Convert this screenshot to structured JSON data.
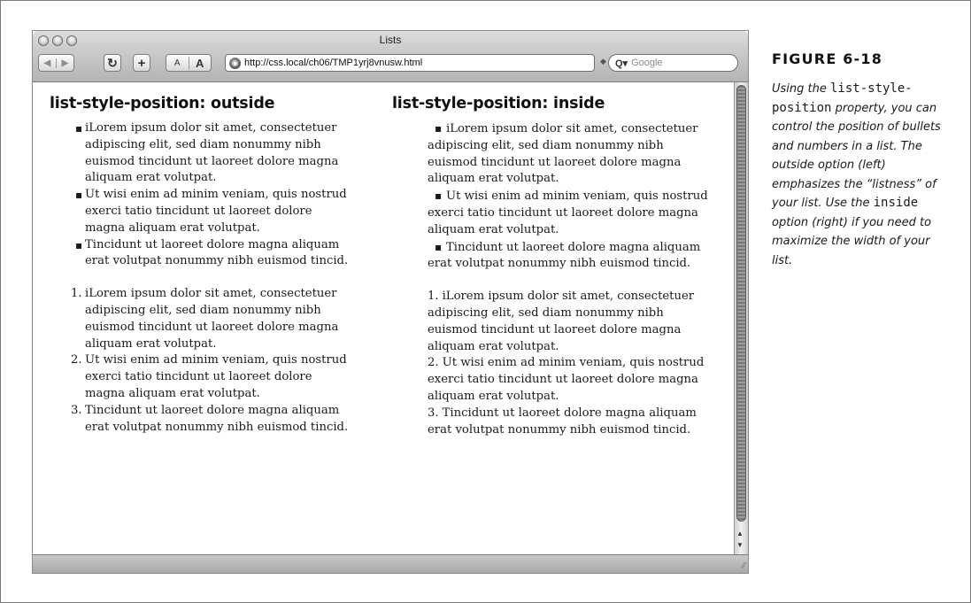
{
  "window": {
    "title": "Lists",
    "url": "http://css.local/ch06/TMP1yrj8vnusw.html",
    "search_placeholder": "Google",
    "text_smaller": "A",
    "text_bigger": "A"
  },
  "columns": {
    "left": {
      "heading": "list-style-position: outside",
      "bullets": [
        "iLorem ipsum dolor sit amet, consectetuer adipiscing elit, sed diam nonummy nibh euismod tincidunt ut laoreet dolore magna aliquam erat volutpat.",
        "Ut wisi enim ad minim veniam, quis nostrud exerci tatio tincidunt ut laoreet dolore magna aliquam erat volutpat.",
        "Tincidunt ut laoreet dolore magna aliquam erat volutpat nonummy nibh euismod tincid."
      ],
      "numbered": [
        "iLorem ipsum dolor sit amet, consectetuer adipiscing elit, sed diam nonummy nibh euismod tincidunt ut laoreet dolore magna aliquam erat volutpat.",
        "Ut wisi enim ad minim veniam, quis nostrud exerci tatio tincidunt ut laoreet dolore magna aliquam erat volutpat.",
        "Tincidunt ut laoreet dolore magna aliquam erat volutpat nonummy nibh euismod tincid."
      ]
    },
    "right": {
      "heading": "list-style-position: inside",
      "bullets": [
        "iLorem ipsum dolor sit amet, consectetuer adipiscing elit, sed diam nonummy nibh euismod tincidunt ut laoreet dolore magna aliquam erat volutpat.",
        "Ut wisi enim ad minim veniam, quis nostrud exerci tatio tincidunt ut laoreet dolore magna aliquam erat volutpat.",
        "Tincidunt ut laoreet dolore magna aliquam erat volutpat nonummy nibh euismod tincid."
      ],
      "numbered": [
        "iLorem ipsum dolor sit amet, consectetuer adipiscing elit, sed diam nonummy nibh euismod tincidunt ut laoreet dolore magna aliquam erat volutpat.",
        "Ut wisi enim ad minim veniam, quis nostrud exerci tatio tincidunt ut laoreet dolore magna aliquam erat volutpat.",
        "Tincidunt ut laoreet dolore magna aliquam erat volutpat nonummy nibh euismod tincid."
      ]
    }
  },
  "markers": {
    "bullet": "▪",
    "numbers": [
      "1.",
      "2.",
      "3."
    ]
  },
  "caption": {
    "label": "FIGURE 6-18",
    "t1": "Using the ",
    "code1": "list-style-position",
    "t2": " property, you can control the position of bullets and numbers in a list. The outside option (left) emphasizes the “listness” of your list. Use the ",
    "code2": "inside",
    "t3": " option (right) if you need to maximize the width of your list."
  },
  "icons": {
    "back": "back-arrow-icon",
    "forward": "forward-arrow-icon",
    "reload": "reload-icon",
    "add_bookmark": "plus-icon",
    "site": "globe-icon",
    "search": "magnifier-icon"
  }
}
